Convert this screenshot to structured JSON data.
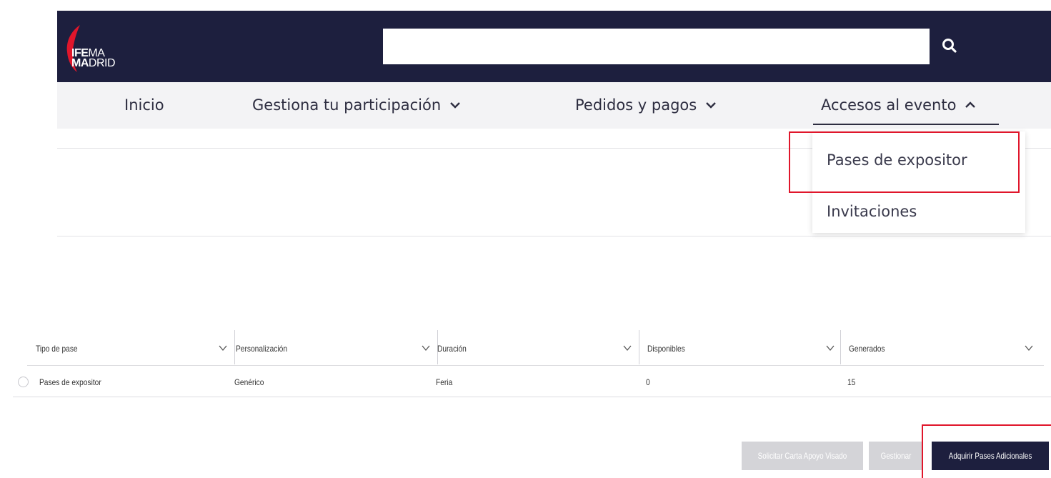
{
  "header": {
    "logo_line1_bold": "IFE",
    "logo_line1_thin": "MA",
    "logo_line2_bold": "MA",
    "logo_line2_thin": "DRID",
    "search_value": "",
    "search_icon": "search-icon",
    "background": "#1d1f3e"
  },
  "nav": {
    "items": [
      {
        "label": "Inicio"
      },
      {
        "label": "Gestiona tu participación",
        "icon": "chevron-down-icon"
      },
      {
        "label": "Pedidos y pagos",
        "icon": "chevron-down-icon"
      },
      {
        "label": "Accesos al evento",
        "icon": "chevron-up-icon"
      }
    ]
  },
  "dropdown": {
    "items": [
      {
        "label": "Pases de expositor"
      },
      {
        "label": "Invitaciones"
      }
    ]
  },
  "table": {
    "columns": [
      "Tipo de pase",
      "Personalización",
      "Duración",
      "Disponibles",
      "Generados"
    ],
    "rows": [
      [
        "Pases de expositor",
        "Genérico",
        "Feria",
        "0",
        "15"
      ]
    ]
  },
  "actions": {
    "solicitar": "Solicitar Carta Apoyo Visado",
    "gestionar": "Gestionar",
    "adquirir": "Adquirir Pases Adicionales"
  },
  "colors": {
    "brand_navy": "#1d1f3e",
    "brand_red": "#e0162b",
    "highlight": "#e0162b"
  }
}
